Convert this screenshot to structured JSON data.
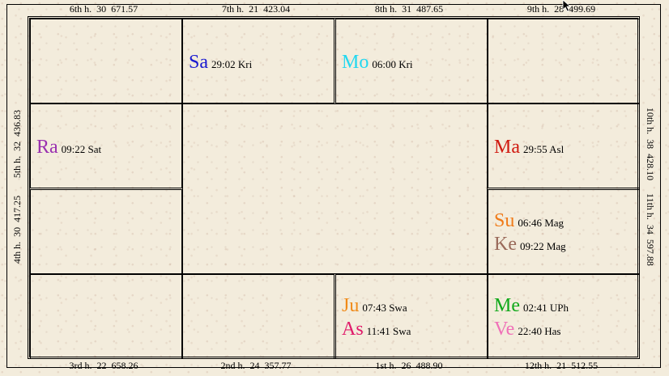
{
  "houses": {
    "h6": "6th h.  30  671.57",
    "h7": "7th h.  21  423.04",
    "h8": "8th h.  31  487.65",
    "h9": "9th h.  28  499.69",
    "h5": "5th h.  32  436.83",
    "h4": "4th h.  30  417.25",
    "h10": "10th h.  38  428.10",
    "h11": "11th h.  34  597.88",
    "h3": "3rd h.  22  658.26",
    "h2": "2nd h.  24  357.77",
    "h1": "1st h.  26  488.90",
    "h12": "12th h.  21  512.55"
  },
  "planets": {
    "sa": {
      "abbr": "Sa",
      "info": "29:02 Kri",
      "color": "#1a1ad0"
    },
    "mo": {
      "abbr": "Mo",
      "info": "06:00 Kri",
      "color": "#22d8f0"
    },
    "ra": {
      "abbr": "Ra",
      "info": "09:22 Sat",
      "color": "#9a30b0"
    },
    "ma": {
      "abbr": "Ma",
      "info": "29:55 Asl",
      "color": "#d01a10"
    },
    "su": {
      "abbr": "Su",
      "info": "06:46 Mag",
      "color": "#f07a18"
    },
    "ke": {
      "abbr": "Ke",
      "info": "09:22 Mag",
      "color": "#9a6a5a"
    },
    "ju": {
      "abbr": "Ju",
      "info": "07:43 Swa",
      "color": "#f08a18"
    },
    "as": {
      "abbr": "As",
      "info": "11:41 Swa",
      "color": "#e01a6a"
    },
    "me": {
      "abbr": "Me",
      "info": "02:41 UPh",
      "color": "#10a81a"
    },
    "ve": {
      "abbr": "Ve",
      "info": "22:40 Has",
      "color": "#f070b8"
    }
  }
}
